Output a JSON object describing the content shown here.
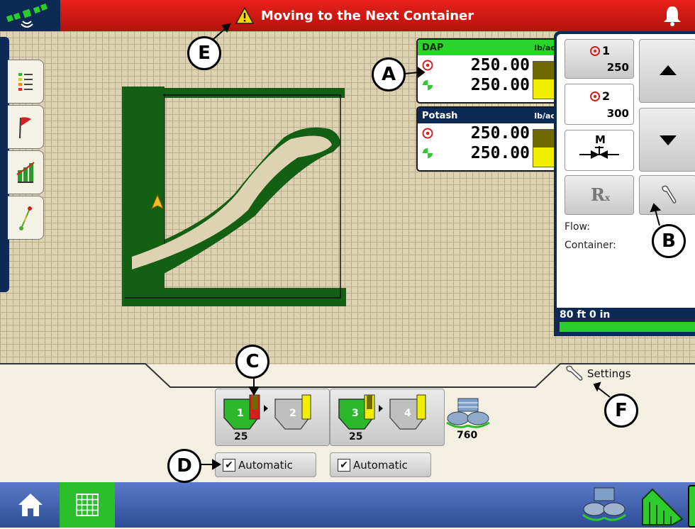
{
  "alert": {
    "message": "Moving to the Next Container"
  },
  "products": [
    {
      "name": "DAP",
      "unit": "lb/ac",
      "target": "250.00",
      "actual": "250.00",
      "header_color": "#2bd42b"
    },
    {
      "name": "Potash",
      "unit": "lb/ac",
      "target": "250.00",
      "actual": "250.00",
      "header_color": "#0d2a55"
    }
  ],
  "presets": [
    {
      "number": "1",
      "rate": "250"
    },
    {
      "number": "2",
      "rate": "300"
    }
  ],
  "right_panel": {
    "manual_label": "M",
    "rx_label": "R",
    "rx_sub": "x",
    "flow_label": "Flow:",
    "container_label": "Container:",
    "swath_width": "80 ft 0 in"
  },
  "sections": [
    {
      "a": "1",
      "b": "2",
      "count": "25",
      "auto_label": "Automatic"
    },
    {
      "a": "3",
      "b": "4",
      "count": "25",
      "auto_label": "Automatic"
    }
  ],
  "spinner": {
    "count": "760"
  },
  "settings": {
    "label": "Settings"
  },
  "callouts": {
    "a": "A",
    "b": "B",
    "c": "C",
    "d": "D",
    "e": "E",
    "f": "F"
  },
  "colors": {
    "alert_red": "#d8180f",
    "navy": "#0d2a55",
    "green": "#2bd42b",
    "coverage": "#135f13",
    "yellow": "#f2ee00"
  },
  "icons": [
    "gps-icon",
    "warning-icon",
    "bell-icon",
    "legend-icon",
    "flag-icon",
    "chart-icon",
    "guidance-icon",
    "target-icon",
    "actual-icon",
    "arrow-up-icon",
    "arrow-down-icon",
    "wrench-icon",
    "home-icon",
    "grid-icon",
    "spinner-icon",
    "field-icon"
  ]
}
